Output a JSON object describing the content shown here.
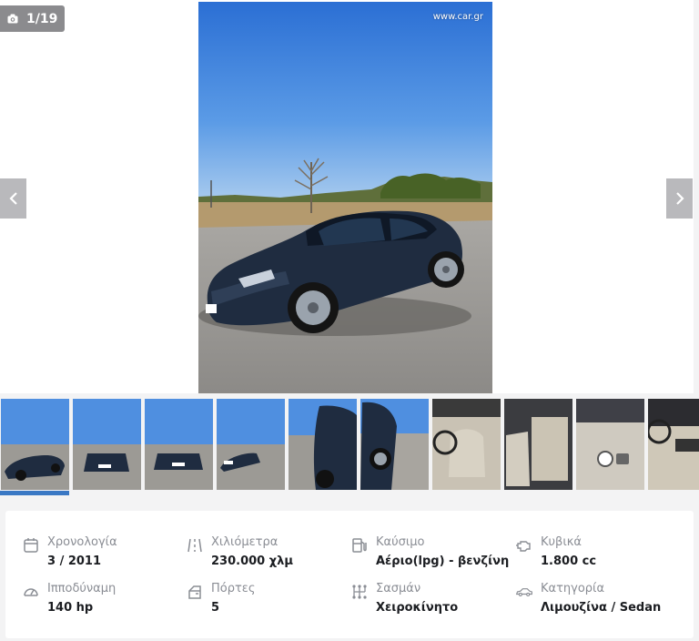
{
  "gallery": {
    "counter": "1/19",
    "watermark": "www.car.gr",
    "thumb_count": 10,
    "active_index": 0
  },
  "specs": {
    "year": {
      "label": "Χρονολογία",
      "value": "3 / 2011",
      "icon": "calendar-icon"
    },
    "mileage": {
      "label": "Χιλιόμετρα",
      "value": "230.000 χλμ",
      "icon": "road-icon"
    },
    "fuel": {
      "label": "Καύσιμο",
      "value": "Αέριο(lpg) - βενζίνη",
      "icon": "fuel-pump-icon"
    },
    "engine": {
      "label": "Κυβικά",
      "value": "1.800 cc",
      "icon": "engine-icon"
    },
    "power": {
      "label": "Ιπποδύναμη",
      "value": "140 hp",
      "icon": "gauge-icon"
    },
    "doors": {
      "label": "Πόρτες",
      "value": "5",
      "icon": "car-door-icon"
    },
    "gearbox": {
      "label": "Σασμάν",
      "value": "Χειροκίνητο",
      "icon": "gearbox-icon"
    },
    "category": {
      "label": "Κατηγορία",
      "value": "Λιμουζίνα / Sedan",
      "icon": "sedan-icon"
    }
  },
  "colors": {
    "accent": "#3a78c4",
    "label": "#8a8d94",
    "value": "#1b1d21"
  }
}
